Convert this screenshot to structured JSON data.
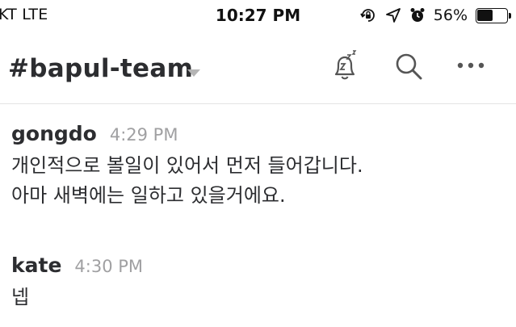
{
  "status_bar": {
    "carrier": "KT  LTE",
    "time": "10:27 PM",
    "battery_percent": "56%",
    "battery_level": 0.56,
    "icons": [
      "rotation-lock-icon",
      "location-arrow-icon",
      "alarm-clock-icon",
      "battery-icon"
    ]
  },
  "header": {
    "channel_name": "#bapul-team",
    "icons": [
      "snooze-bell-icon",
      "search-icon",
      "more-icon"
    ]
  },
  "messages": [
    {
      "author": "gongdo",
      "time": "4:29 PM",
      "lines": [
        "개인적으로 볼일이 있어서 먼저 들어갑니다.",
        "아마 새벽에는 일하고 있을거에요."
      ]
    },
    {
      "author": "kate",
      "time": "4:30 PM",
      "lines": [
        "넵"
      ]
    }
  ],
  "colors": {
    "text": "#2c2d30",
    "timestamp": "#a0a0a2",
    "divider": "#e3e3e3",
    "icon": "#555555"
  }
}
